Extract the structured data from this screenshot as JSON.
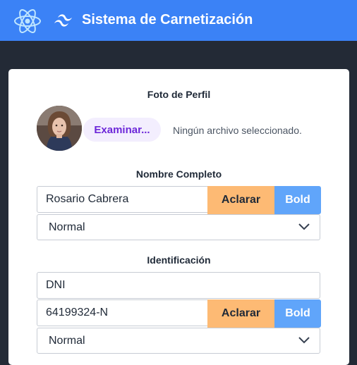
{
  "header": {
    "title": "Sistema de Carnetización",
    "react_icon": "react-logo-icon",
    "tailwind_icon": "tailwind-logo-icon",
    "background_color": "#3b82f6"
  },
  "photo": {
    "label": "Foto de Perfil",
    "browse_button": "Examinar...",
    "file_status": "Ningún archivo seleccionado."
  },
  "name": {
    "label": "Nombre Completo",
    "value": "Rosario Cabrera",
    "clear_button": "Aclarar",
    "bold_button": "Bold",
    "style_select": "Normal"
  },
  "identification": {
    "label": "Identificación",
    "type_value": "DNI",
    "number_value": "64199324-N",
    "clear_button": "Aclarar",
    "bold_button": "Bold",
    "style_select": "Normal"
  },
  "colors": {
    "clear_button": "#fdba74",
    "bold_button": "#60a5fa",
    "browse_button_text": "#6d28d9"
  }
}
